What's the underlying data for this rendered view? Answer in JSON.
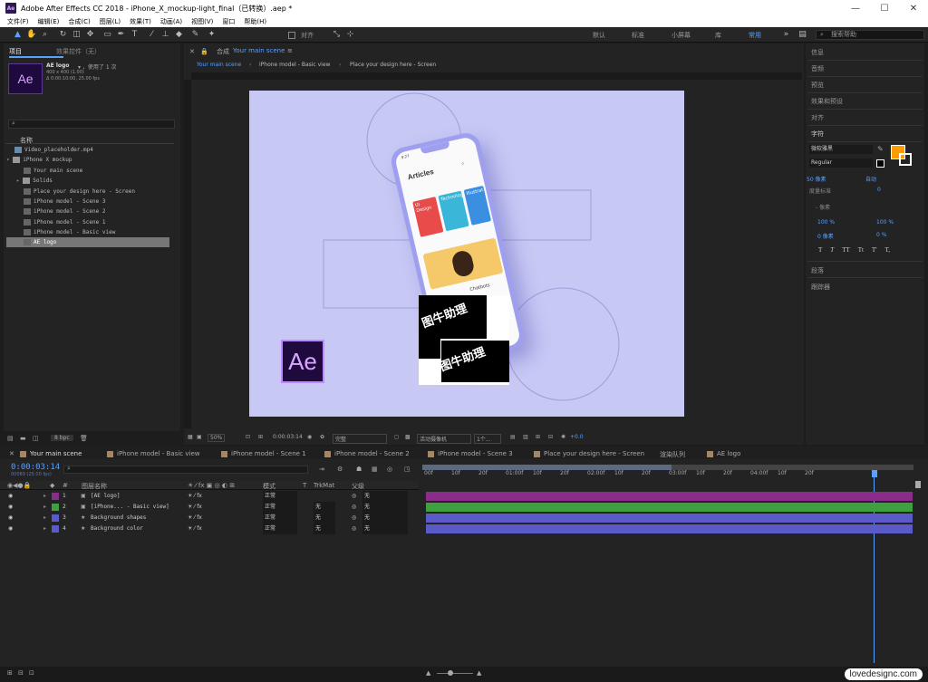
{
  "window": {
    "title": "Adobe After Effects CC 2018 - iPhone_X_mockup-light_final（已转换）.aep *",
    "min": "—",
    "max": "☐",
    "close": "✕"
  },
  "menu": [
    "文件(F)",
    "编辑(E)",
    "合成(C)",
    "图层(L)",
    "效果(T)",
    "动画(A)",
    "视图(V)",
    "窗口",
    "帮助(H)"
  ],
  "toolbar": {
    "align_label": "对齐",
    "workspaces": [
      "默认",
      "标准",
      "小屏幕",
      "库"
    ],
    "active_workspace": "常用",
    "search_placeholder": "搜索帮助"
  },
  "project": {
    "tab_project": "项目",
    "tab_effects": "效果控件（无）",
    "selected_name": "AE logo",
    "selected_usage": "▾ ，使用了 1 次",
    "selected_size": "400 x 400 (1.00)",
    "selected_duration": "Δ 0:00:10:00, 25.00 fps",
    "column_name": "名称",
    "thumb_label": "Ae",
    "items": [
      "Video_placeholder.mp4",
      "iPhone X mockup",
      "Your main scene",
      "Solids",
      "Place your design here - Screen",
      "iPhone model - Scene 3",
      "iPhone model - Scene 2",
      "iPhone model - Scene 1",
      "iPhone model - Basic view",
      "AE logo"
    ],
    "bpc": "8 bpc"
  },
  "comp": {
    "tab_label": "合成",
    "tab_name": "Your main scene",
    "breadcrumbs": [
      "Your main scene",
      "iPhone model - Basic view",
      "Place your design here - Screen"
    ],
    "zoom": "50%",
    "time": "0:00:03:14",
    "quality": "完整",
    "camera": "活动摄像机",
    "views": "1个...",
    "exposure": "+0.0",
    "phone_header": "Articles",
    "phone_cards": [
      "UI Design",
      "Technology",
      "Illustrat"
    ],
    "phone_time": "9:27",
    "phone_caption": "Chatbots",
    "watermark": [
      "图牛助理",
      "图牛助理"
    ],
    "ae_logo": "Ae"
  },
  "right_panel": {
    "items": [
      "信息",
      "音频",
      "预览",
      "效果和预设",
      "对齐",
      "字符"
    ],
    "font": "微软雅黑",
    "font_style": "Regular",
    "font_size": "50 像素",
    "leading": "自动",
    "kerning": "度量标准",
    "tracking": "0",
    "stroke_unit": "- 像素",
    "vscale": "100 %",
    "hscale": "100 %",
    "baseline": "0 像素",
    "tsume": "0 %",
    "styles": [
      "T",
      "T",
      "TT",
      "Tt",
      "T'",
      "T,"
    ],
    "bottom_items": [
      "段落",
      "跟踪器"
    ],
    "accent": "#ff9d00"
  },
  "timeline": {
    "tabs": [
      "Your main scene",
      "iPhone model - Basic view",
      "iPhone model - Scene 1",
      "iPhone model - Scene 2",
      "iPhone model - Scene 3",
      "Place your design here - Screen",
      "渲染队列",
      "AE logo"
    ],
    "time": "0:00:03:14",
    "fps": "00089 (25.00 fps)",
    "columns": {
      "num": "#",
      "name": "图层名称",
      "mode": "模式",
      "t": "T",
      "trkmat": "TrkMat",
      "parent": "父级"
    },
    "ruler_labels": [
      "00f",
      "10f",
      "20f",
      "01:00f",
      "10f",
      "20f",
      "02:00f",
      "10f",
      "20f",
      "03:00f",
      "10f",
      "20f",
      "04:00f",
      "10f",
      "20f"
    ],
    "layers": [
      {
        "num": "1",
        "name": "[AE logo]",
        "mode": "正常",
        "trkmat": "",
        "parent": "无",
        "color": "#8a2d8a"
      },
      {
        "num": "2",
        "name": "[iPhone... - Basic view]",
        "mode": "正常",
        "trkmat": "无",
        "parent": "无",
        "color": "#3fa03f"
      },
      {
        "num": "3",
        "name": "Background shapes",
        "mode": "正常",
        "trkmat": "无",
        "parent": "无",
        "color": "#5a5ac8"
      },
      {
        "num": "4",
        "name": "Background color",
        "mode": "正常",
        "trkmat": "无",
        "parent": "无",
        "color": "#5a5ac8"
      }
    ]
  },
  "credit": "lovedesignc.com"
}
